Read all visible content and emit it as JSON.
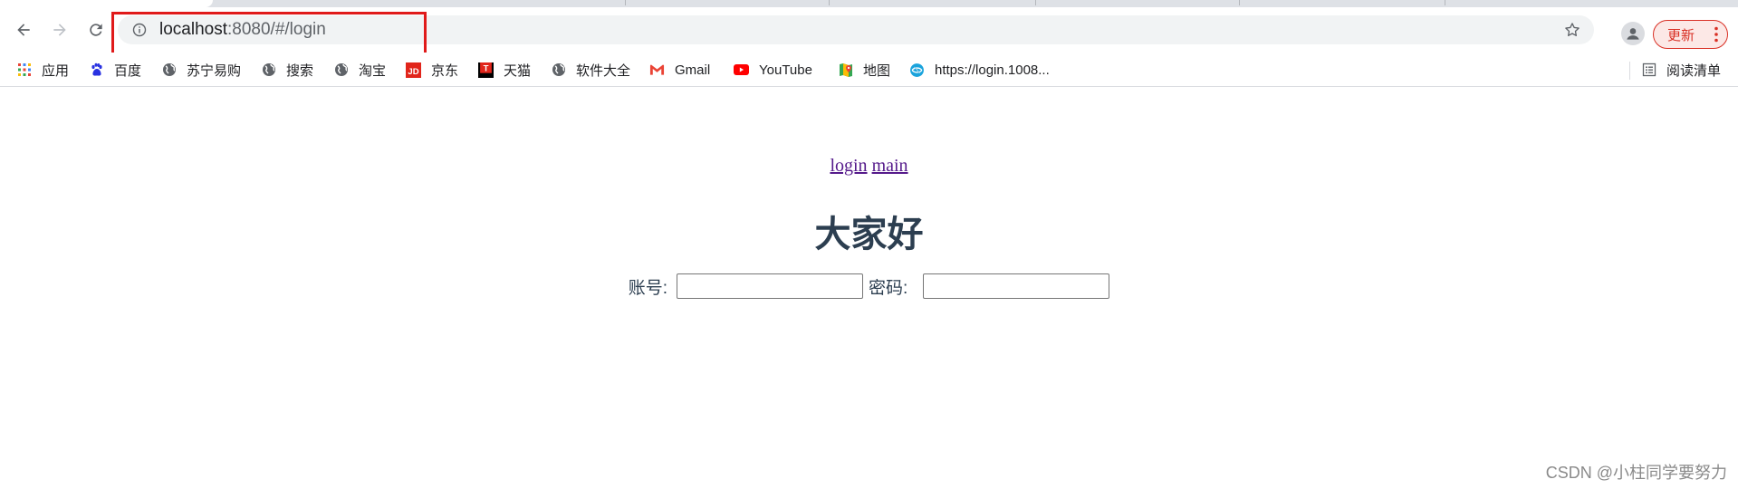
{
  "browser": {
    "address_bar": {
      "host": "localhost",
      "rest": ":8080/#/login"
    },
    "update_label": "更新",
    "bookmarks": [
      {
        "label": "应用",
        "icon": "apps-grid-icon"
      },
      {
        "label": "百度",
        "icon": "baidu-paw-icon"
      },
      {
        "label": "苏宁易购",
        "icon": "globe-icon"
      },
      {
        "label": "搜索",
        "icon": "globe-icon"
      },
      {
        "label": "淘宝",
        "icon": "globe-icon"
      },
      {
        "label": "京东",
        "icon": "jd-icon"
      },
      {
        "label": "天猫",
        "icon": "tmall-icon"
      },
      {
        "label": "软件大全",
        "icon": "globe-icon"
      },
      {
        "label": "Gmail",
        "icon": "gmail-icon"
      },
      {
        "label": "YouTube",
        "icon": "youtube-icon"
      },
      {
        "label": "地图",
        "icon": "maps-icon"
      },
      {
        "label": "https://login.1008...",
        "icon": "site-icon"
      }
    ],
    "reading_list_label": "阅读清单"
  },
  "page": {
    "nav_links": [
      "login",
      "main"
    ],
    "greeting": "大家好",
    "account_label": "账号:",
    "password_label": "密码:",
    "account_value": "",
    "password_value": ""
  },
  "watermark": "CSDN @小柱同学要努力",
  "colors": {
    "highlight_box": "#e01a1a",
    "heading": "#2c3e50",
    "visited_link": "#551a8b",
    "update_button": "#d93025"
  }
}
